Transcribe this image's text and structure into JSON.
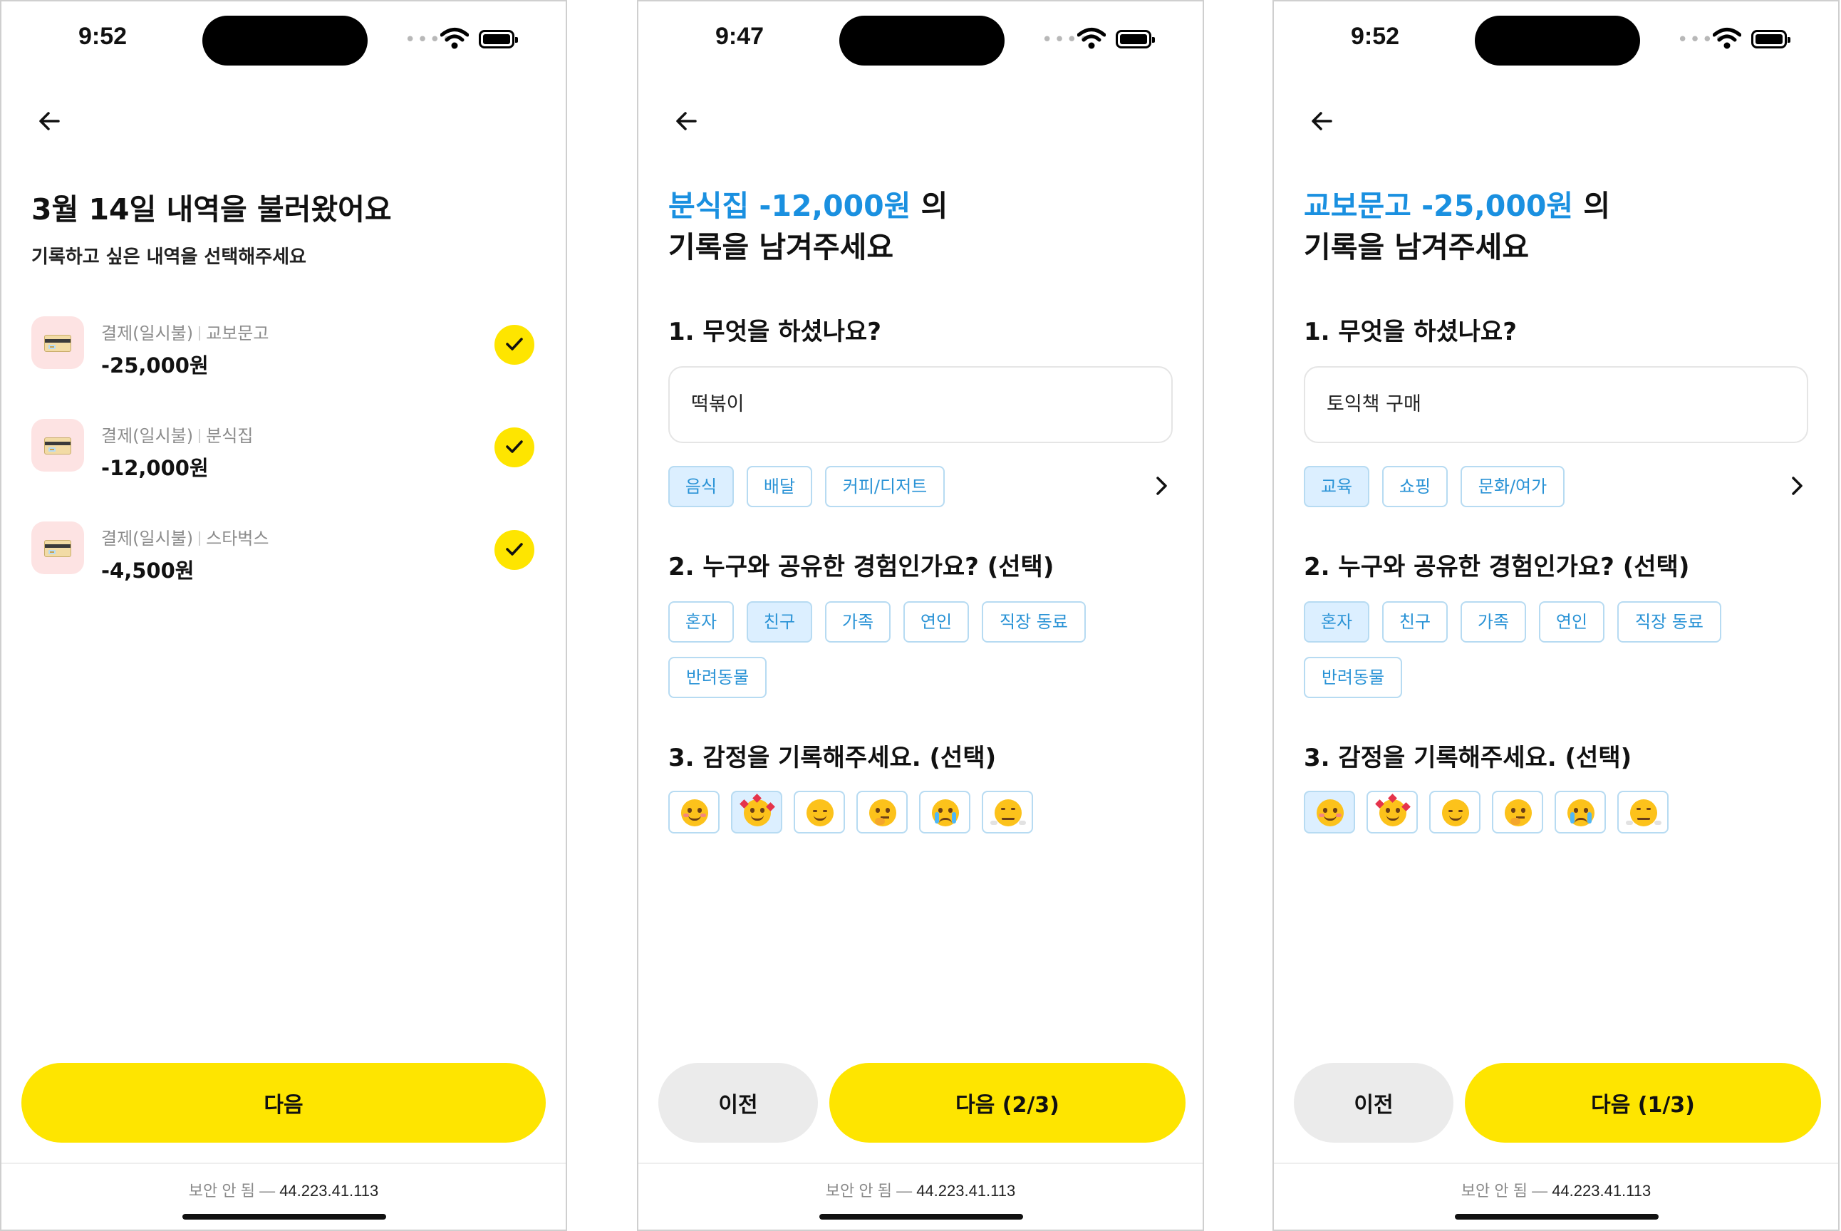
{
  "screen1": {
    "status": {
      "time": "9:52"
    },
    "title": "3월 14일 내역을 불러왔어요",
    "subtitle": "기록하고 싶은 내역을 선택해주세요",
    "transactions": [
      {
        "type": "결제(일시불)",
        "merchant": "교보문고",
        "amount": "-25,000원",
        "checked": true
      },
      {
        "type": "결제(일시불)",
        "merchant": "분식집",
        "amount": "-12,000원",
        "checked": true
      },
      {
        "type": "결제(일시불)",
        "merchant": "스타벅스",
        "amount": "-4,500원",
        "checked": true
      }
    ],
    "next_label": "다음",
    "footer": {
      "insecure": "보안 안 됨",
      "dash": "—",
      "url": "44.223.41.113"
    }
  },
  "screen2": {
    "status": {
      "time": "9:47"
    },
    "title_highlight": "분식집 -12,000원",
    "title_rest": " 의",
    "title_line2": "기록을 남겨주세요",
    "q1": "1. 무엇을 하셨나요?",
    "q1_value": "떡볶이",
    "q1_chips": [
      {
        "label": "음식",
        "selected": true
      },
      {
        "label": "배달",
        "selected": false
      },
      {
        "label": "커피/디저트",
        "selected": false
      }
    ],
    "q2": "2. 누구와 공유한 경험인가요? (선택)",
    "q2_chips": [
      {
        "label": "혼자",
        "selected": false
      },
      {
        "label": "친구",
        "selected": true
      },
      {
        "label": "가족",
        "selected": false
      },
      {
        "label": "연인",
        "selected": false
      },
      {
        "label": "직장 동료",
        "selected": false
      },
      {
        "label": "반려동물",
        "selected": false
      }
    ],
    "q3": "3. 감정을 기록해주세요. (선택)",
    "emotions_selected": "smiling-hearts",
    "prev_label": "이전",
    "next_label": "다음 (2/3)",
    "footer": {
      "insecure": "보안 안 됨",
      "dash": "—",
      "url": "44.223.41.113"
    }
  },
  "screen3": {
    "status": {
      "time": "9:52"
    },
    "title_highlight": "교보문고 -25,000원",
    "title_rest": " 의",
    "title_line2": "기록을 남겨주세요",
    "q1": "1. 무엇을 하셨나요?",
    "q1_value": "토익책 구매",
    "q1_chips": [
      {
        "label": "교육",
        "selected": true
      },
      {
        "label": "쇼핑",
        "selected": false
      },
      {
        "label": "문화/여가",
        "selected": false
      }
    ],
    "q2": "2. 누구와 공유한 경험인가요? (선택)",
    "q2_chips": [
      {
        "label": "혼자",
        "selected": true
      },
      {
        "label": "친구",
        "selected": false
      },
      {
        "label": "가족",
        "selected": false
      },
      {
        "label": "연인",
        "selected": false
      },
      {
        "label": "직장 동료",
        "selected": false
      },
      {
        "label": "반려동물",
        "selected": false
      }
    ],
    "q3": "3. 감정을 기록해주세요. (선택)",
    "emotions_selected": "smiling",
    "prev_label": "이전",
    "next_label": "다음 (1/3)",
    "footer": {
      "insecure": "보안 안 됨",
      "dash": "—",
      "url": "44.223.41.113"
    }
  },
  "emotions": [
    "smiling",
    "smiling-hearts",
    "relieved",
    "thinking",
    "crying",
    "huffing"
  ],
  "colors": {
    "accent_yellow": "#fee500",
    "highlight_blue": "#1a90e0",
    "chip_border": "#b7dbf2",
    "chip_selected_bg": "#dcefff",
    "secondary_button": "#ebebeb"
  },
  "icons": {
    "back": "arrow-left-icon",
    "next_chips": "chevron-right-icon",
    "check": "check-icon",
    "wifi": "wifi-icon",
    "battery": "battery-icon",
    "card": "credit-card-icon"
  }
}
